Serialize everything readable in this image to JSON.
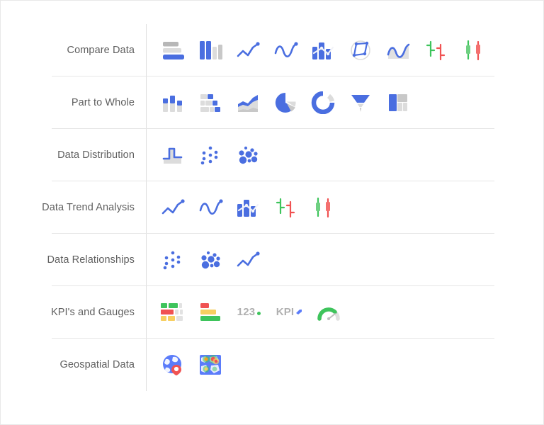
{
  "page": {
    "background": "#ffffff",
    "border_color": "#e8e8e8"
  },
  "colors": {
    "accent_blue": "#4a6ee0",
    "blue_light": "#5b7cfa",
    "gray_dark": "#b7b7b7",
    "gray_light": "#dcdcdc",
    "gray_mid": "#c8c8c8",
    "green": "#3ec45c",
    "green_soft": "#6fd082",
    "red": "#f05252",
    "yellow": "#f7cf61",
    "label_text": "#5f5f5f",
    "divider": "#e6e6e6",
    "vertical_rule": "#dedede"
  },
  "categories": [
    {
      "label": "Compare Data",
      "icons": [
        {
          "name": "bar-chart-icon",
          "type": "bar"
        },
        {
          "name": "column-chart-icon",
          "type": "column"
        },
        {
          "name": "line-chart-icon",
          "type": "line"
        },
        {
          "name": "spline-chart-icon",
          "type": "spline"
        },
        {
          "name": "combo-chart-icon",
          "type": "combo"
        },
        {
          "name": "radar-chart-icon",
          "type": "radar"
        },
        {
          "name": "area-chart-icon",
          "type": "area"
        },
        {
          "name": "ohlc-chart-icon",
          "type": "ohlc"
        },
        {
          "name": "candlestick-chart-icon",
          "type": "candlestick"
        }
      ]
    },
    {
      "label": "Part to Whole",
      "icons": [
        {
          "name": "stacked-column-chart-icon",
          "type": "stacked-column"
        },
        {
          "name": "stacked-bar-chart-icon",
          "type": "stacked-bar"
        },
        {
          "name": "stacked-area-chart-icon",
          "type": "stacked-area"
        },
        {
          "name": "pie-chart-icon",
          "type": "pie"
        },
        {
          "name": "donut-chart-icon",
          "type": "donut"
        },
        {
          "name": "funnel-chart-icon",
          "type": "funnel"
        },
        {
          "name": "treemap-chart-icon",
          "type": "treemap"
        }
      ]
    },
    {
      "label": "Data Distribution",
      "icons": [
        {
          "name": "histogram-chart-icon",
          "type": "histogram"
        },
        {
          "name": "scatter-plot-icon",
          "type": "scatter"
        },
        {
          "name": "bubble-chart-icon",
          "type": "bubble"
        }
      ]
    },
    {
      "label": "Data Trend Analysis",
      "icons": [
        {
          "name": "line-chart-icon",
          "type": "line"
        },
        {
          "name": "spline-chart-icon",
          "type": "spline"
        },
        {
          "name": "combo-chart-icon",
          "type": "combo"
        },
        {
          "name": "ohlc-chart-icon",
          "type": "ohlc"
        },
        {
          "name": "candlestick-chart-icon",
          "type": "candlestick"
        }
      ]
    },
    {
      "label": "Data Relationships",
      "icons": [
        {
          "name": "scatter-plot-icon",
          "type": "scatter"
        },
        {
          "name": "bubble-chart-icon",
          "type": "bubble"
        },
        {
          "name": "line-chart-icon",
          "type": "line"
        }
      ]
    },
    {
      "label": "KPI's and Gauges",
      "icons": [
        {
          "name": "kpi-scorecard-grid-icon",
          "type": "scorecard-grid"
        },
        {
          "name": "kpi-bullet-bars-icon",
          "type": "bullet-bars"
        },
        {
          "name": "numeric-kpi-icon",
          "type": "text-123",
          "text": "123"
        },
        {
          "name": "kpi-label-icon",
          "type": "text-kpi",
          "text": "KPI"
        },
        {
          "name": "gauge-chart-icon",
          "type": "gauge"
        }
      ]
    },
    {
      "label": "Geospatial Data",
      "icons": [
        {
          "name": "globe-map-icon",
          "type": "globe"
        },
        {
          "name": "heat-map-icon",
          "type": "heatmap"
        }
      ]
    }
  ]
}
